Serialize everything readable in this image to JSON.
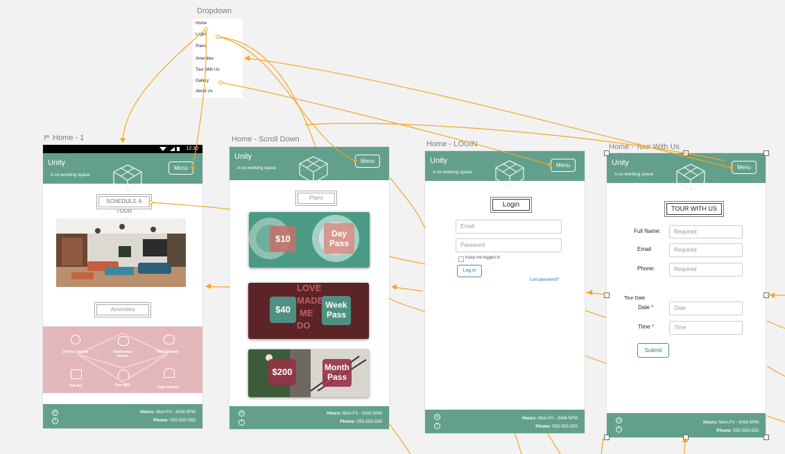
{
  "labels": {
    "dropdown": "Dropdown",
    "home": "Home - 1",
    "scroll": "Home - Scroll Down",
    "login": "Home - LOGIN",
    "tour": "Home - Tour With Us"
  },
  "dropdown": {
    "items": [
      "Home",
      "Login",
      "Plans",
      "Amenities",
      "Tour With Us",
      "Gallery",
      "About Us"
    ]
  },
  "status_bar": {
    "time": "12:30"
  },
  "header": {
    "brand": "Unity",
    "tagline": "A co-working space",
    "menu": "Menu"
  },
  "home": {
    "schedule_button": "SCHEDULE A TOUR",
    "amenities_button": "Amenities",
    "amenities": [
      "24 Hour Access",
      "Conference Rooms",
      "Pets Allowed",
      "Full Bar",
      "Free WiFi",
      "Yoga Classes"
    ]
  },
  "scroll": {
    "plans_button": "Plans",
    "plans": [
      {
        "price": "$10",
        "name": "Day Pass"
      },
      {
        "price": "$40",
        "name": "Week Pass"
      },
      {
        "price": "$200",
        "name": "Month Pass"
      }
    ]
  },
  "login": {
    "title": "Login",
    "email_placeholder": "Email",
    "password_placeholder": "Password",
    "remember": "Keep me logged in",
    "login_button": "Log in",
    "lost_password": "Lost password?"
  },
  "tour": {
    "title": "TOUR WITH US",
    "full_name_label": "Full Name:",
    "email_label": "Email",
    "phone_label": "Phone:",
    "required_placeholder": "Required",
    "tour_date_label": "Tour Date",
    "date_label": "Date",
    "time_label": "Time",
    "date_placeholder": "Date",
    "time_placeholder": "Time",
    "submit": "Submit"
  },
  "footer": {
    "hours_label": "Hours:",
    "hours": "Mon-Fri - 9AM-5PM",
    "phone_label": "Phone:",
    "phone": "555-555-555"
  },
  "colors": {
    "brand": "#62a08c",
    "connector": "#f5a623",
    "canvas": "#f2f2f2"
  }
}
